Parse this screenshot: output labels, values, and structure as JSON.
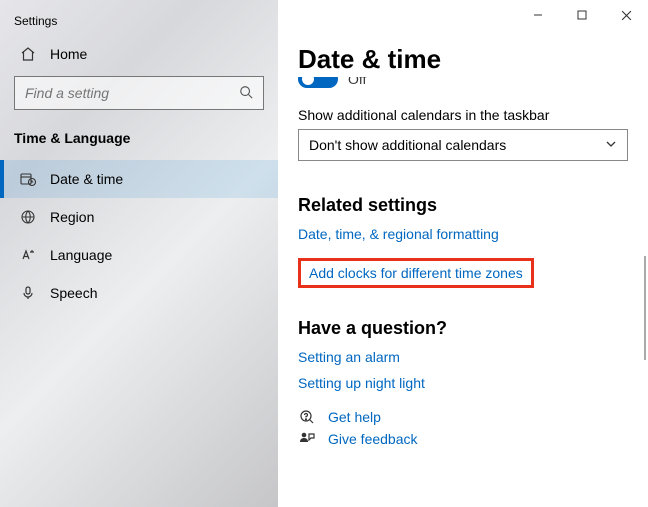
{
  "window_title": "Settings",
  "home_label": "Home",
  "search_placeholder": "Find a setting",
  "category": "Time & Language",
  "nav": {
    "date_time": "Date & time",
    "region": "Region",
    "language": "Language",
    "speech": "Speech"
  },
  "page_title": "Date & time",
  "toggle_partial": "Off",
  "additional_label": "Show additional calendars in the taskbar",
  "dropdown_value": "Don't show additional calendars",
  "related_heading": "Related settings",
  "link_formatting": "Date, time, & regional formatting",
  "link_add_clocks": "Add clocks for different time zones",
  "question_heading": "Have a question?",
  "link_alarm": "Setting an alarm",
  "link_night": "Setting up night light",
  "link_help": "Get help",
  "link_feedback": "Give feedback"
}
